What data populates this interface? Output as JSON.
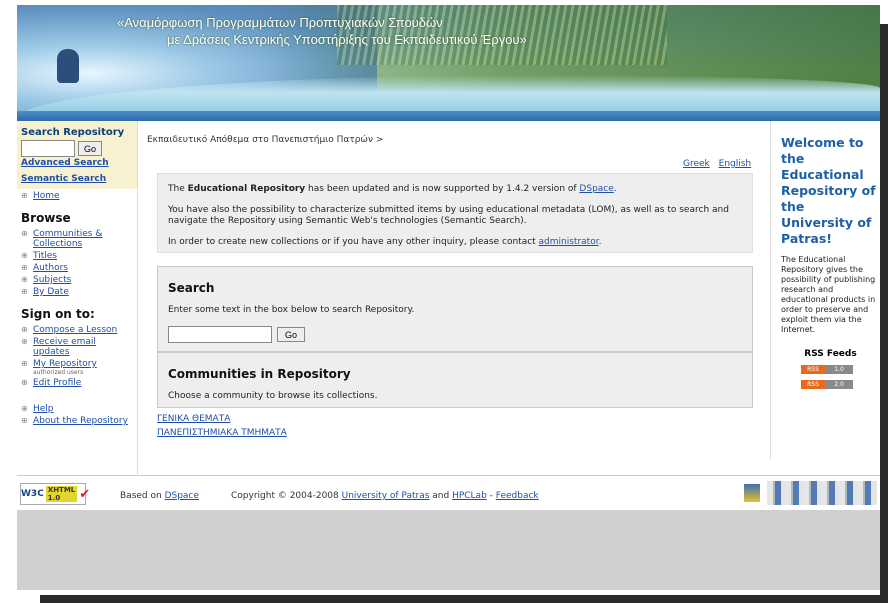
{
  "banner": {
    "title_line1": "«Αναμόρφωση Προγραμμάτων Προπτυχιακών Σπουδών",
    "title_line2": "με Δράσεις Κεντρικής Υποστήριξης του Εκπαιδευτικού Έργου»"
  },
  "sidebar": {
    "search_title": "Search Repository",
    "go_label": "Go",
    "advanced_search": "Advanced Search",
    "semantic_search": "Semantic Search",
    "home": "Home",
    "browse_heading": "Browse",
    "browse_items": [
      {
        "label": "Communities & Collections"
      },
      {
        "label": "Titles"
      },
      {
        "label": "Authors"
      },
      {
        "label": "Subjects"
      },
      {
        "label": "By Date"
      }
    ],
    "signon_heading": "Sign on to:",
    "signon_items": [
      {
        "label": "Compose a Lesson"
      },
      {
        "label": "Receive email updates"
      },
      {
        "label": "My Repository",
        "note": "authorized users"
      },
      {
        "label": "Edit Profile"
      }
    ],
    "help": "Help",
    "about": "About the Repository"
  },
  "main": {
    "breadcrumb": "Εκπαιδευτικό Απόθεμα στο Πανεπιστήμιο Πατρών >",
    "lang_greek": "Greek",
    "lang_english": "English",
    "news": {
      "p1_pre": "The ",
      "p1_bold": "Educational Repository",
      "p1_mid": " has been updated and is now supported by 1.4.2 version of ",
      "p1_link": "DSpace",
      "p1_end": ".",
      "p2": "You have also the possibility to characterize submitted items by using educational metadata (LOM), as well as to search and navigate the Repository using Semantic Web's technologies (Semantic Search).",
      "p3_pre": "In order to create new collections or if you have any other inquiry, please contact ",
      "p3_link": "administrator",
      "p3_end": "."
    },
    "search": {
      "heading": "Search",
      "desc": "Enter some text in the box below to search Repository.",
      "go_label": "Go"
    },
    "communities": {
      "heading": "Communities in Repository",
      "desc": "Choose a community to browse its collections.",
      "items": [
        {
          "label": "ΓΕΝΙΚΑ ΘΕΜΑΤΑ"
        },
        {
          "label": "ΠΑΝΕΠΙΣΤΗΜΙΑΚΑ ΤΜΗΜΑΤΑ"
        }
      ]
    }
  },
  "right": {
    "welcome": "Welcome to the Educational Repository of the University of Patras!",
    "desc": "The Educational Repository gives the possibility of publishing research and educational products in order to preserve and exploit them via the Internet.",
    "rss_heading": "RSS Feeds",
    "rss_badge": "RSS",
    "rss_versions": [
      "1.0",
      "2.0"
    ]
  },
  "footer": {
    "w3c": "W3C",
    "xhtml": "XHTML 1.0",
    "based_pre": "Based on ",
    "based_link": "DSpace",
    "copy_pre": "Copyright © 2004-2008 ",
    "copy_link1": "University of Patras",
    "copy_and": " and ",
    "copy_link2": "HPCLab",
    "copy_sep": " - ",
    "copy_link3": "Feedback"
  }
}
